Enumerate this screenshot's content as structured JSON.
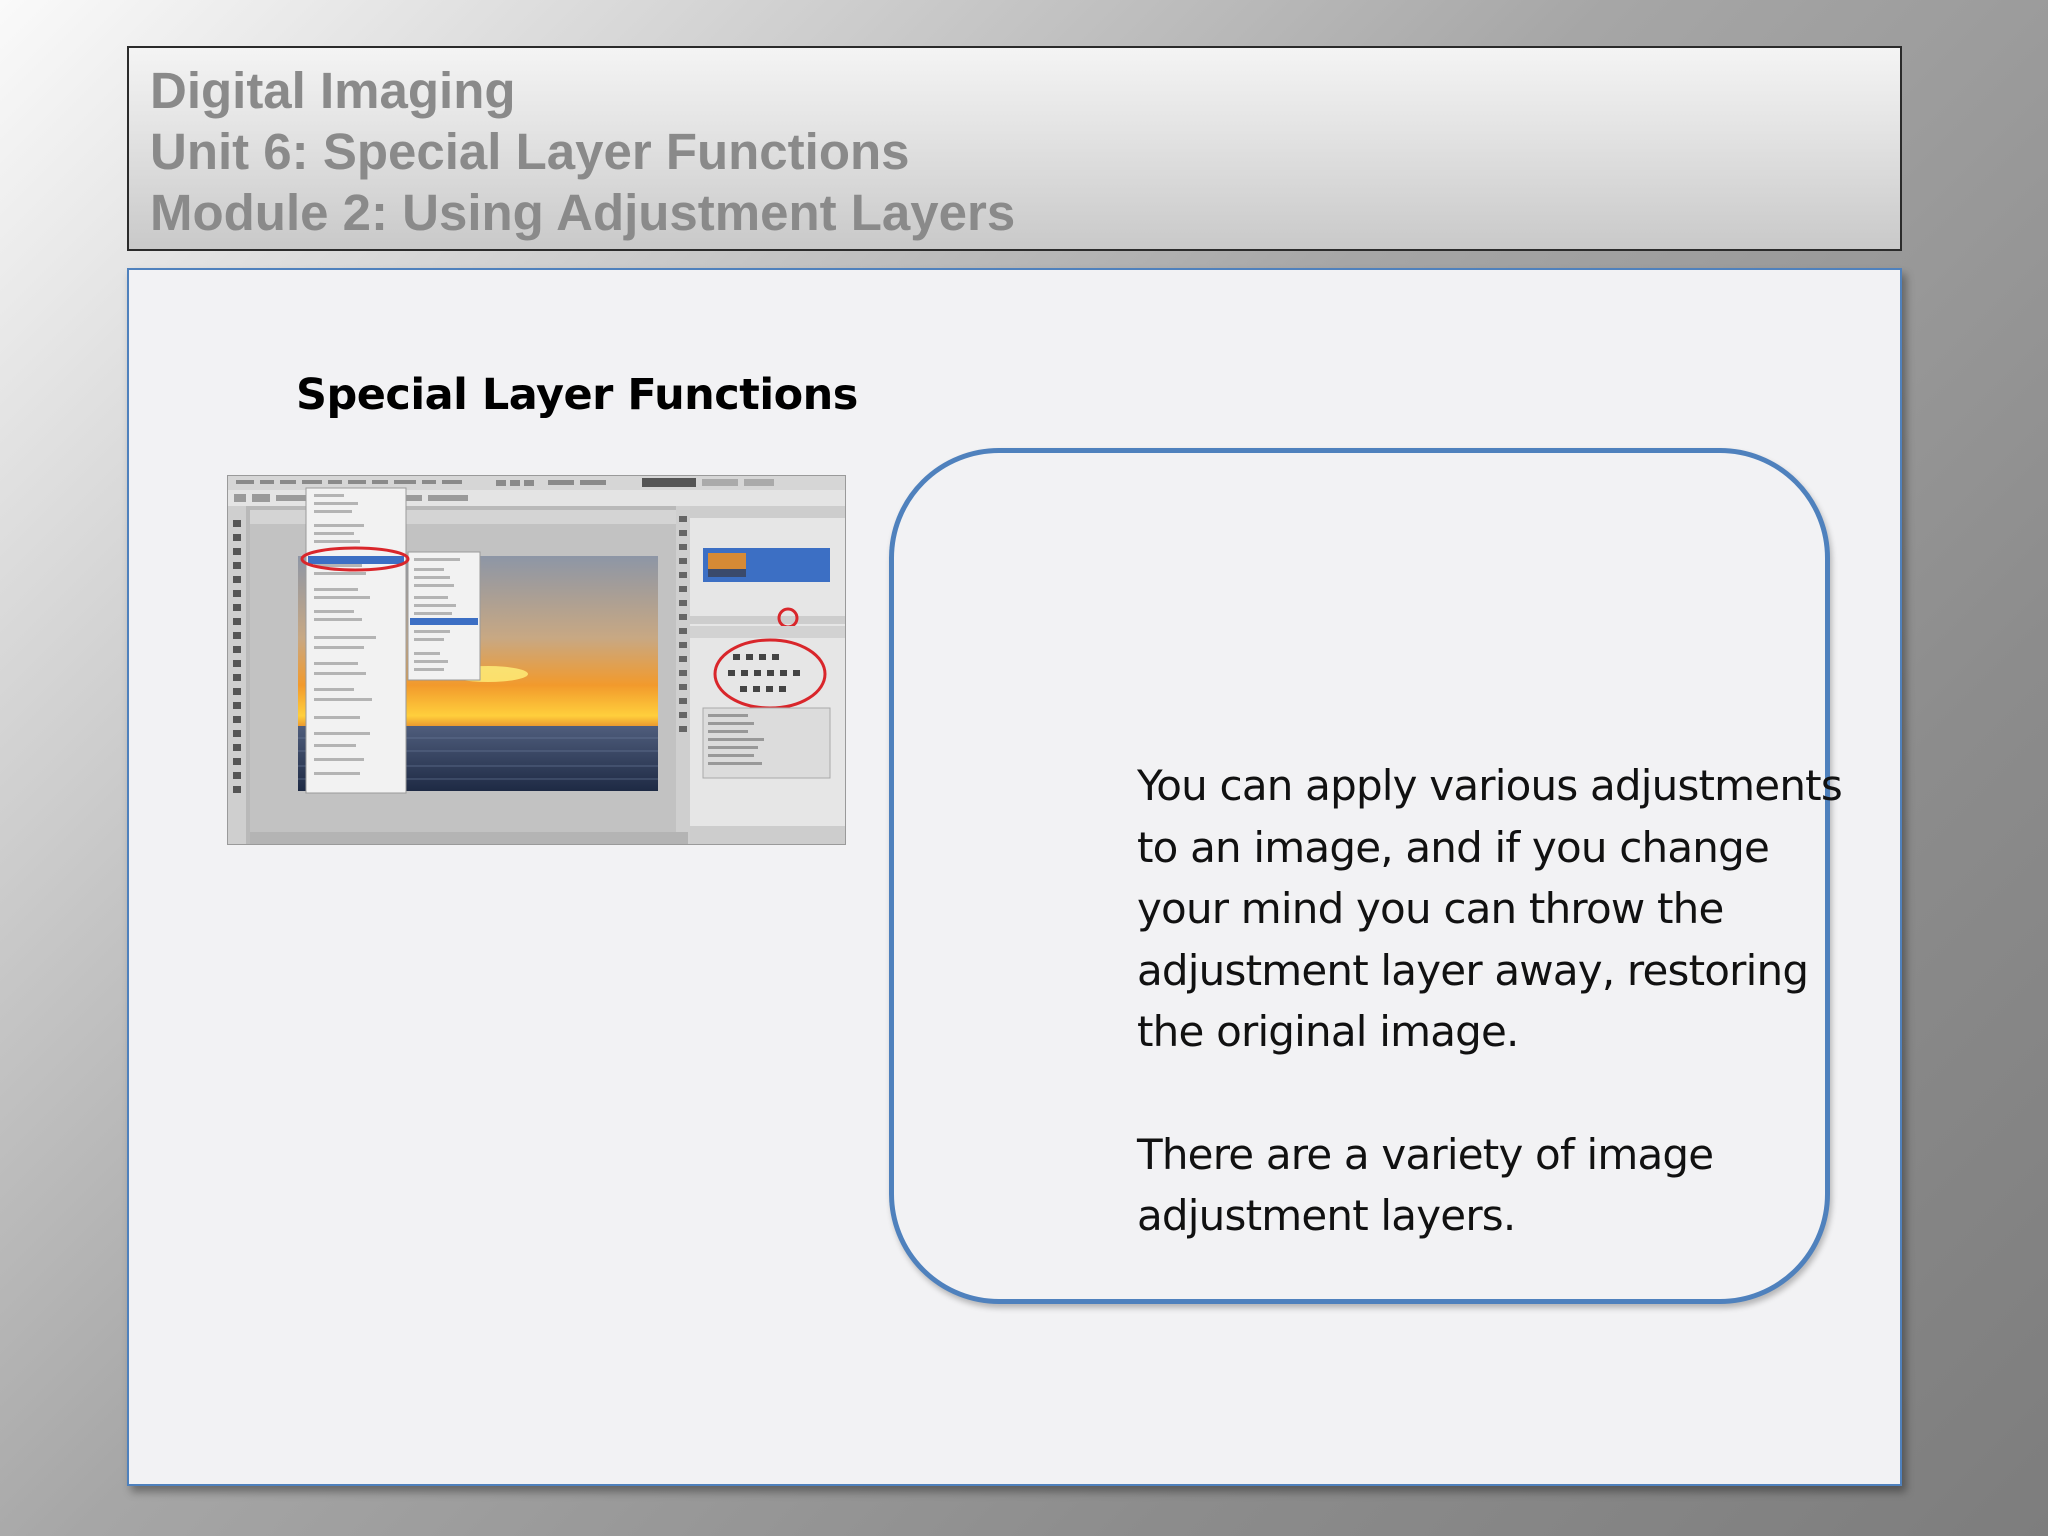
{
  "header": {
    "line1": "Digital Imaging",
    "line2": "Unit 6: Special Layer Functions",
    "line3": "Module 2: Using Adjustment Layers"
  },
  "main": {
    "section_title": "Special Layer Functions",
    "callout": {
      "paragraph1": "You can apply various adjustments to an image, and if you change your mind you can throw the adjustment layer away, restoring the original image.",
      "paragraph2": "There are a variety of image adjustment layers."
    }
  },
  "colors": {
    "accent_border": "#4f81bd",
    "header_text": "#8a8a8a",
    "highlight_circle": "#d9262b"
  }
}
